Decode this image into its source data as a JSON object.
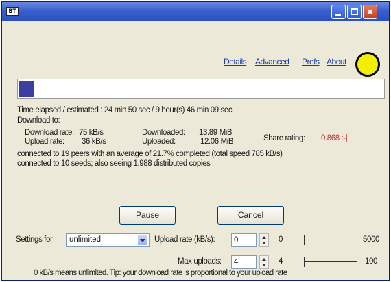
{
  "window": {
    "title": "BT",
    "controls": {
      "minimize": "minimize",
      "maximize": "maximize",
      "close": "close"
    }
  },
  "links": {
    "details": "Details",
    "advanced": "Advanced",
    "prefs": "Prefs",
    "about": "About"
  },
  "status_light_color": "#f2f000",
  "progress": {
    "fraction": 0.04
  },
  "time_line": "Time elapsed / estimated : 24 min 50 sec / 9 hour(s) 46 min 09 sec",
  "download_to": "Download to:",
  "stats": {
    "download_rate_label": "Download rate:",
    "download_rate": "75 kB/s",
    "upload_rate_label": "Upload rate:",
    "upload_rate": "36 kB/s",
    "downloaded_label": "Downloaded:",
    "downloaded": "13.89 MiB",
    "uploaded_label": "Uploaded:",
    "uploaded": "12.06 MiB",
    "share_rating_label": "Share rating:",
    "share_rating": "0.868 :-|"
  },
  "peers_line": "connected to 19 peers with an average of 21.7% completed (total speed 785 kB/s)",
  "seeds_line": "connected to 10 seeds; also seeing 1.988 distributed copies",
  "buttons": {
    "pause": "Pause",
    "cancel": "Cancel"
  },
  "settings": {
    "settings_for_label": "Settings for",
    "settings_for_value": "unlimited",
    "upload_rate_label": "Upload rate (kB/s):",
    "upload_rate_value": "0",
    "upload_rate_current": "0",
    "upload_rate_max": "5000",
    "max_uploads_label": "Max uploads:",
    "max_uploads_value": "4",
    "max_uploads_current": "4",
    "max_uploads_max": "100"
  },
  "tip": "0 kB/s means unlimited. Tip: your download rate is proportional to your upload rate"
}
